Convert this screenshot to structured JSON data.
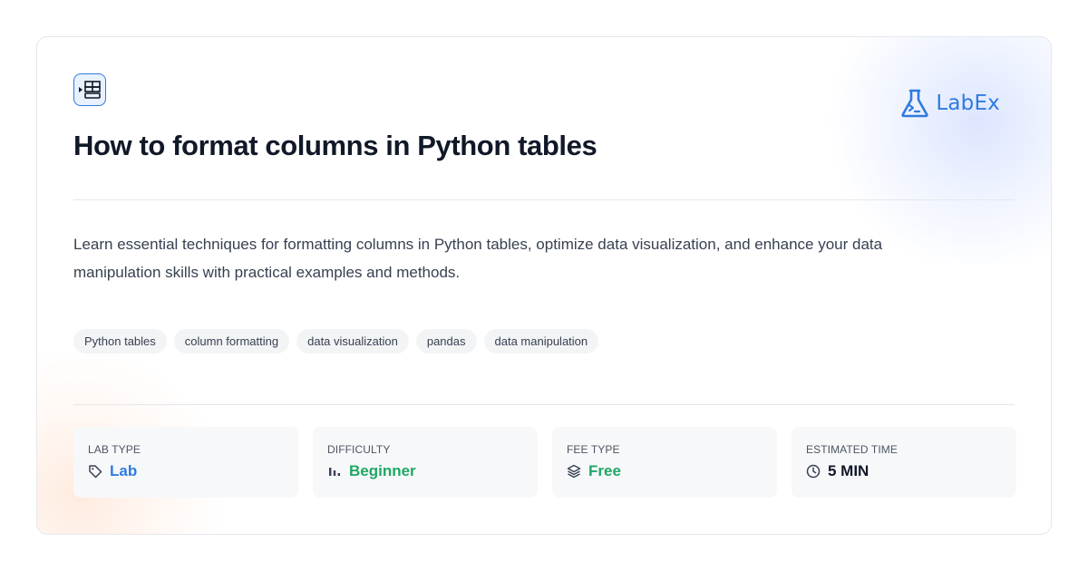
{
  "header": {
    "topic_icon": "table-columns-icon",
    "logo_text": "LabEx",
    "logo_icon": "flask-terminal-icon",
    "title": "How to format columns in Python tables"
  },
  "description": "Learn essential techniques for formatting columns in Python tables, optimize data visualization, and enhance your data manipulation skills with practical examples and methods.",
  "tags": [
    "Python tables",
    "column formatting",
    "data visualization",
    "pandas",
    "data manipulation"
  ],
  "stats": [
    {
      "label": "LAB TYPE",
      "value": "Lab",
      "icon": "tag-icon",
      "color": "#2e7be0"
    },
    {
      "label": "DIFFICULTY",
      "value": "Beginner",
      "icon": "bar-chart-icon",
      "color": "#1fa865"
    },
    {
      "label": "FEE TYPE",
      "value": "Free",
      "icon": "layers-icon",
      "color": "#1fa865"
    },
    {
      "label": "ESTIMATED TIME",
      "value": "5 MIN",
      "icon": "clock-icon",
      "color": "#111827"
    }
  ],
  "colors": {
    "brand": "#2e7be0",
    "success": "#1fa865",
    "text": "#111827",
    "muted": "#374151",
    "tag_bg": "#f3f4f6",
    "stat_bg": "#f7f8fa"
  }
}
